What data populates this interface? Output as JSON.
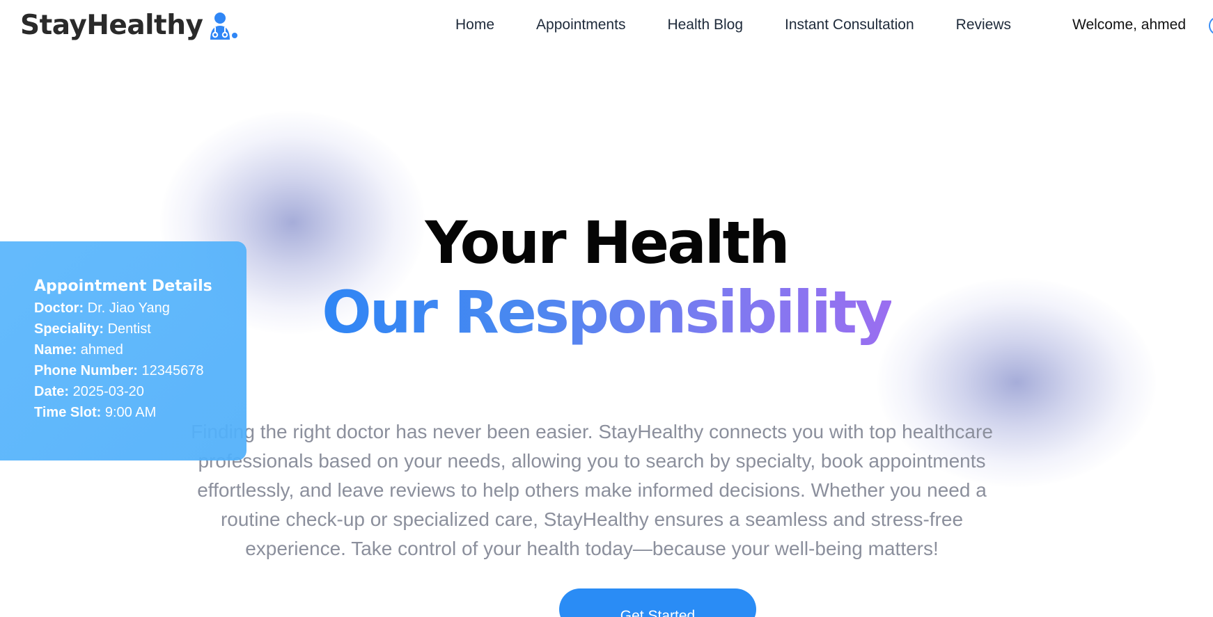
{
  "brand": {
    "name": "StayHealthy",
    "icon": "doctor-stethoscope-icon",
    "icon_color": "#2f86f5"
  },
  "nav": {
    "links": [
      "Home",
      "Appointments",
      "Health Blog",
      "Instant Consultation",
      "Reviews"
    ],
    "welcome": "Welcome, ahmed"
  },
  "hero": {
    "line1": "Your Health",
    "line2": "Our Responsibility",
    "gradient": [
      "#2f86f5",
      "#9a6ef0"
    ],
    "description": "Finding the right doctor has never been easier. StayHealthy connects you with top healthcare professionals based on your needs, allowing you to search by specialty, book appointments effortlessly, and leave reviews to help others make informed decisions. Whether you need a routine check-up or specialized care, StayHealthy ensures a seamless and stress-free experience. Take control of your health today—because your well-being matters!",
    "cta": "Get Started",
    "cta_color": "#2a8cf5"
  },
  "appointment": {
    "title": "Appointment Details",
    "card_color": "#5cb7fc",
    "fields": [
      {
        "label": "Doctor:",
        "value": "Dr. Jiao Yang"
      },
      {
        "label": "Speciality:",
        "value": "Dentist"
      },
      {
        "label": "Name:",
        "value": "ahmed"
      },
      {
        "label": "Phone Number:",
        "value": "12345678"
      },
      {
        "label": "Date:",
        "value": "2025-03-20"
      },
      {
        "label": "Time Slot:",
        "value": "9:00 AM"
      }
    ]
  }
}
